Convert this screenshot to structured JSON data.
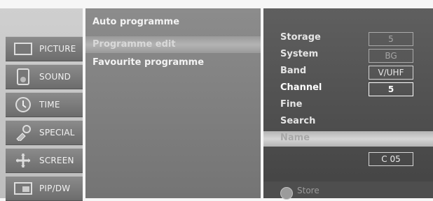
{
  "main_menu": {
    "items": [
      {
        "label": "PICTURE",
        "icon": "picture-icon"
      },
      {
        "label": "SOUND",
        "icon": "sound-icon"
      },
      {
        "label": "TIME",
        "icon": "time-icon"
      },
      {
        "label": "SPECIAL",
        "icon": "special-icon"
      },
      {
        "label": "SCREEN",
        "icon": "screen-icon"
      },
      {
        "label": "PIP/DW",
        "icon": "pip-icon"
      }
    ]
  },
  "sub_menu": {
    "items": [
      {
        "label": "Auto programme"
      },
      {
        "label": "Programme edit"
      },
      {
        "label": "Favourite programme"
      }
    ],
    "selected": "Programme edit"
  },
  "detail": {
    "fields": [
      {
        "label": "Storage",
        "value": "5",
        "state": "dim"
      },
      {
        "label": "System",
        "value": "BG",
        "state": "dim"
      },
      {
        "label": "Band",
        "value": "V/UHF",
        "state": "normal"
      },
      {
        "label": "Channel",
        "value": "5",
        "state": "bright"
      },
      {
        "label": "Fine",
        "value": "",
        "state": "normal"
      },
      {
        "label": "Search",
        "value": "",
        "state": "normal"
      },
      {
        "label": "Name",
        "value": "C 05",
        "state": "selected"
      }
    ],
    "store_label": "Store"
  },
  "colors": {
    "sidebar_item": "#7b7b7b",
    "submenu_bg": "#7f7f7f",
    "panel_bg": "#505050",
    "highlight": "#c9c9c9"
  }
}
